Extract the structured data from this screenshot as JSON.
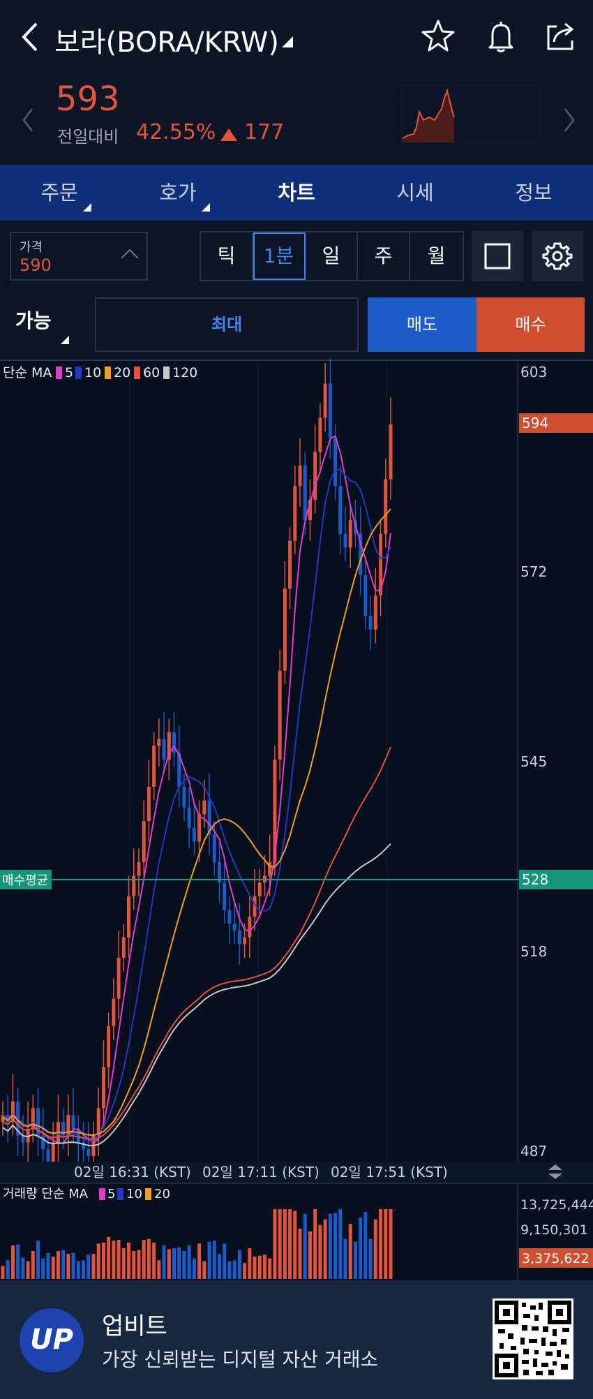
{
  "header": {
    "title": "보라(BORA/KRW)",
    "icons": [
      "back-arrow-icon",
      "star-icon",
      "bell-icon",
      "share-icon"
    ]
  },
  "ticker": {
    "price": "593",
    "change_label": "전일대비",
    "change_pct": "42.55%",
    "change_abs": "177",
    "direction": "up",
    "up_color": "#e2553c"
  },
  "tabs": [
    {
      "label": "주문"
    },
    {
      "label": "호가"
    },
    {
      "label": "차트",
      "active": true
    },
    {
      "label": "시세"
    },
    {
      "label": "정보"
    }
  ],
  "controls": {
    "price_label": "가격",
    "price_value": "590",
    "intervals": [
      "틱",
      "1분",
      "일",
      "주",
      "월"
    ],
    "active_interval": "1분"
  },
  "order": {
    "available_label": "가능",
    "max_label": "최대",
    "sell_label": "매도",
    "buy_label": "매수",
    "sell_color": "#1b5cc8",
    "buy_color": "#cf4e30"
  },
  "chart": {
    "ma_prefix": "단순 MA",
    "ma_periods": [
      {
        "label": "5",
        "color": "#e23bd0"
      },
      {
        "label": "10",
        "color": "#2438c8"
      },
      {
        "label": "20",
        "color": "#f0a020"
      },
      {
        "label": "60",
        "color": "#e2553c"
      },
      {
        "label": "120",
        "color": "#c8c8c8"
      }
    ],
    "price_axis": [
      "603",
      "572",
      "545",
      "518",
      "487"
    ],
    "current_price_tag": "594",
    "avg_buy_label": "매수평균",
    "avg_buy_value": "528",
    "time_labels": [
      "02일 16:31 (KST)",
      "02일 17:11 (KST)",
      "02일 17:51 (KST)"
    ],
    "volume_prefix": "거래량 단순 MA",
    "volume_ma_periods": [
      {
        "label": "5",
        "color": "#e23bd0"
      },
      {
        "label": "10",
        "color": "#2438c8"
      },
      {
        "label": "20",
        "color": "#f0a020"
      }
    ],
    "volume_axis": [
      "13,725,444",
      "9,150,301"
    ],
    "volume_current_tag": "3,375,622"
  },
  "chart_data": {
    "type": "candlestick",
    "interval": "1분",
    "ylim": [
      487,
      603
    ],
    "close_series": [
      493,
      492,
      495,
      490,
      489,
      491,
      494,
      490,
      488,
      486,
      489,
      492,
      490,
      493,
      491,
      489,
      488,
      487,
      490,
      494,
      500,
      506,
      510,
      516,
      519,
      525,
      528,
      530,
      536,
      541,
      547,
      548,
      545,
      549,
      546,
      541,
      538,
      535,
      533,
      537,
      539,
      534,
      530,
      527,
      523,
      521,
      520,
      518,
      519,
      522,
      525,
      527,
      528,
      530,
      545,
      558,
      570,
      577,
      585,
      588,
      580,
      583,
      590,
      595,
      600,
      592,
      585,
      578,
      576,
      580,
      578,
      572,
      566,
      564,
      569,
      578,
      586,
      594
    ]
  },
  "banner": {
    "brand": "업비트",
    "slogan": "가장 신뢰받는 디지털 자산 거래소",
    "logo_text": "UP"
  }
}
